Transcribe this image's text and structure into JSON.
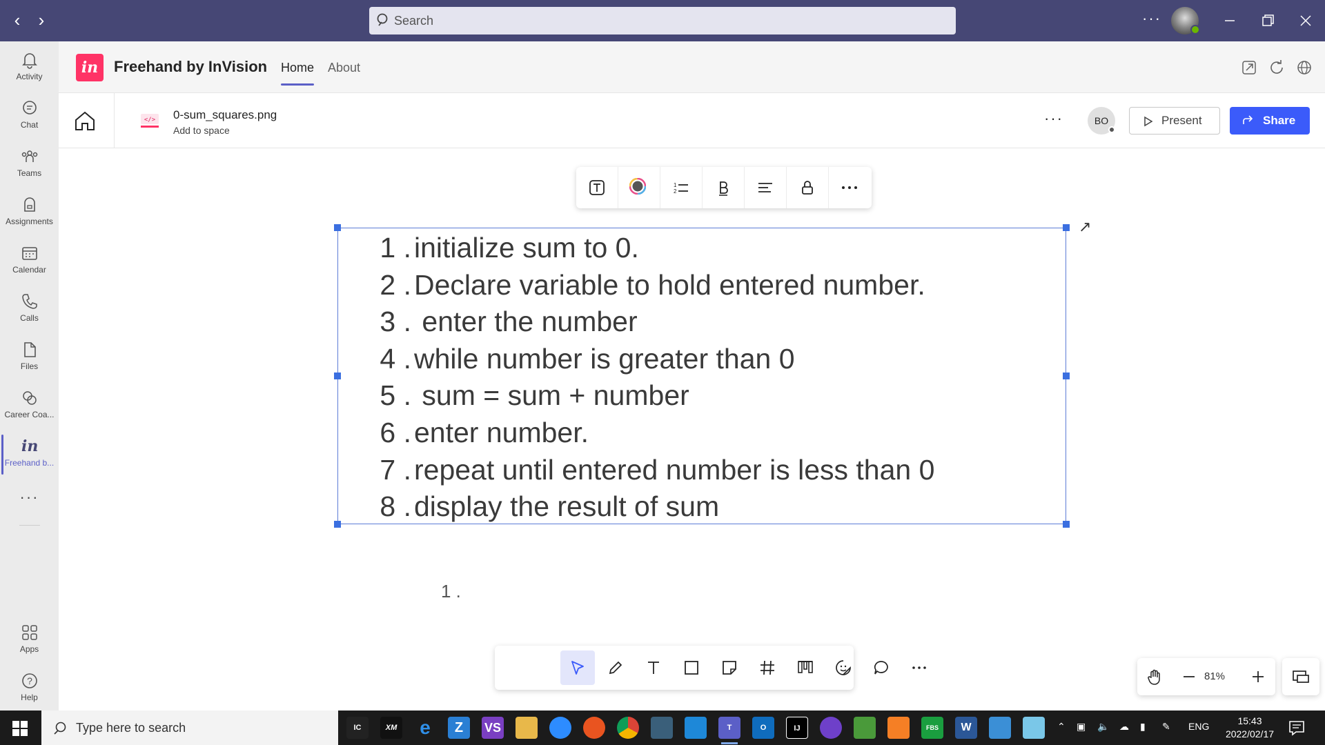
{
  "window": {
    "search_placeholder": "Search",
    "more": "···"
  },
  "rail": {
    "items": [
      {
        "label": "Activity",
        "icon": "bell-icon"
      },
      {
        "label": "Chat",
        "icon": "chat-icon"
      },
      {
        "label": "Teams",
        "icon": "teams-icon"
      },
      {
        "label": "Assignments",
        "icon": "assignments-icon"
      },
      {
        "label": "Calendar",
        "icon": "calendar-icon"
      },
      {
        "label": "Calls",
        "icon": "phone-icon"
      },
      {
        "label": "Files",
        "icon": "file-icon"
      },
      {
        "label": "Career Coa...",
        "icon": "career-coach-icon"
      },
      {
        "label": "Freehand b...",
        "icon": "invision-icon"
      }
    ],
    "more": "···",
    "bottom": [
      {
        "label": "Apps",
        "icon": "apps-icon"
      },
      {
        "label": "Help",
        "icon": "help-icon"
      }
    ]
  },
  "app": {
    "logo_text": "in",
    "title": "Freehand by InVision",
    "tabs": [
      "Home",
      "About"
    ],
    "active_tab": "Home",
    "accent": "#5b5fc7",
    "brand": "#ff3366"
  },
  "file": {
    "name": "0-sum_squares.png",
    "subtitle": "Add to space",
    "more": "···",
    "avatar_initials": "BO",
    "present_label": "Present",
    "share_label": "Share",
    "share_color": "#3b5bfa"
  },
  "canvas": {
    "steps": [
      {
        "num": "1 .",
        "text": "initialize sum to 0."
      },
      {
        "num": "2 .",
        "text": "Declare variable to hold entered number."
      },
      {
        "num": "3 .",
        "text": " enter the number"
      },
      {
        "num": "4 .",
        "text": "while number is greater than 0"
      },
      {
        "num": "5 .",
        "text": " sum = sum + number"
      },
      {
        "num": "6 .",
        "text": "enter number."
      },
      {
        "num": "7 .",
        "text": "repeat until entered number is less than 0"
      },
      {
        "num": "8 .",
        "text": "display the result of sum"
      }
    ],
    "stray_list_marker": "1 .",
    "toolbar_more": "···",
    "zoom": "81%"
  },
  "taskbar": {
    "search_placeholder": "Type here to search",
    "language": "ENG",
    "time": "15:43",
    "date": "2022/02/17"
  }
}
